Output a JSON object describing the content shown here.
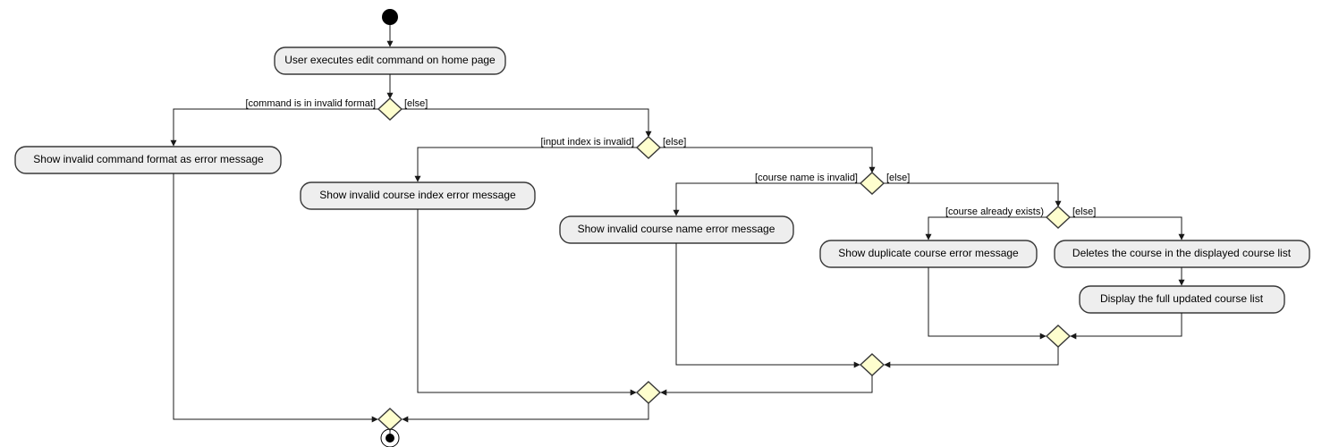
{
  "start_action": "User executes edit command on home page",
  "d1": {
    "left_guard": "[command is in invalid format]",
    "right_guard": "[else]",
    "left_action": "Show invalid command format as error message"
  },
  "d2": {
    "left_guard": "[input index is invalid]",
    "right_guard": "[else]",
    "left_action": "Show invalid course index error message"
  },
  "d3": {
    "left_guard": "[course name is invalid]",
    "right_guard": "[else]",
    "left_action": "Show invalid course name error message"
  },
  "d4": {
    "left_guard": "[course already exists)",
    "right_guard": "[else]",
    "right_action_1": "Deletes the course in the displayed course list",
    "right_action_2": "Display the full updated course list",
    "left_action": "Show duplicate course error message"
  }
}
